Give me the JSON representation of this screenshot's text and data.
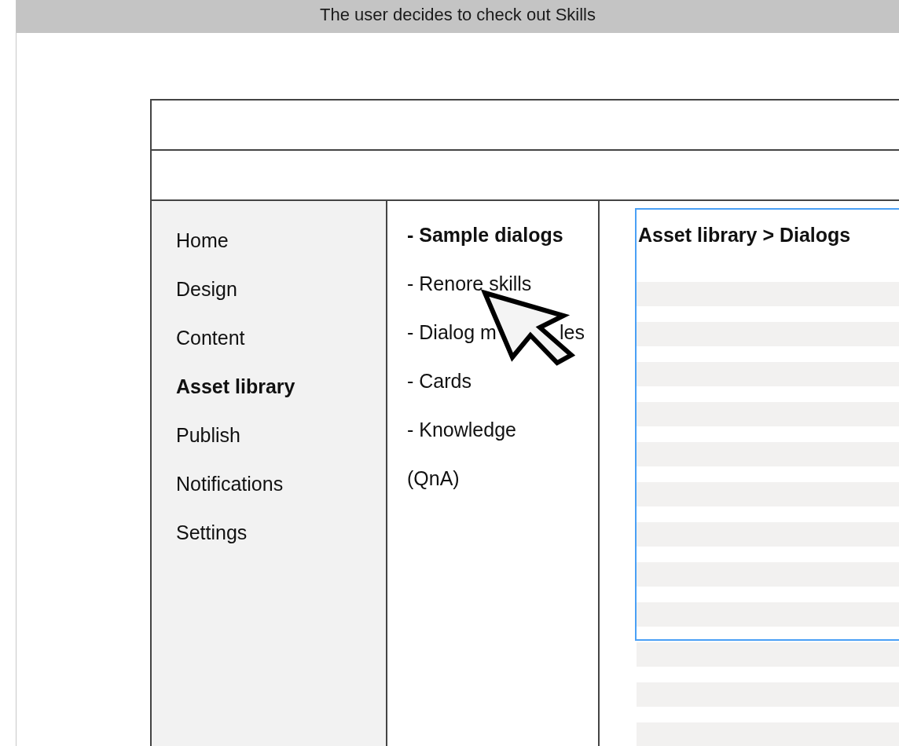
{
  "banner": {
    "title": "The user decides to check out Skills"
  },
  "sidebar": {
    "items": [
      {
        "label": "Home",
        "selected": false
      },
      {
        "label": "Design",
        "selected": false
      },
      {
        "label": "Content",
        "selected": false
      },
      {
        "label": "Asset library",
        "selected": true
      },
      {
        "label": "Publish",
        "selected": false
      },
      {
        "label": "Notifications",
        "selected": false
      },
      {
        "label": "Settings",
        "selected": false
      }
    ]
  },
  "submenu": {
    "items": [
      {
        "label": "- Sample dialogs",
        "selected": true
      },
      {
        "label": "- Renore skills",
        "selected": false
      },
      {
        "label": "- Dialog m",
        "label_after_cursor": "les",
        "selected": false
      },
      {
        "label": "- Cards",
        "selected": false
      },
      {
        "label": "- Knowledge",
        "selected": false
      },
      {
        "label": "(QnA)",
        "selected": false
      }
    ]
  },
  "content": {
    "breadcrumb": "Asset library > Dialogs"
  }
}
